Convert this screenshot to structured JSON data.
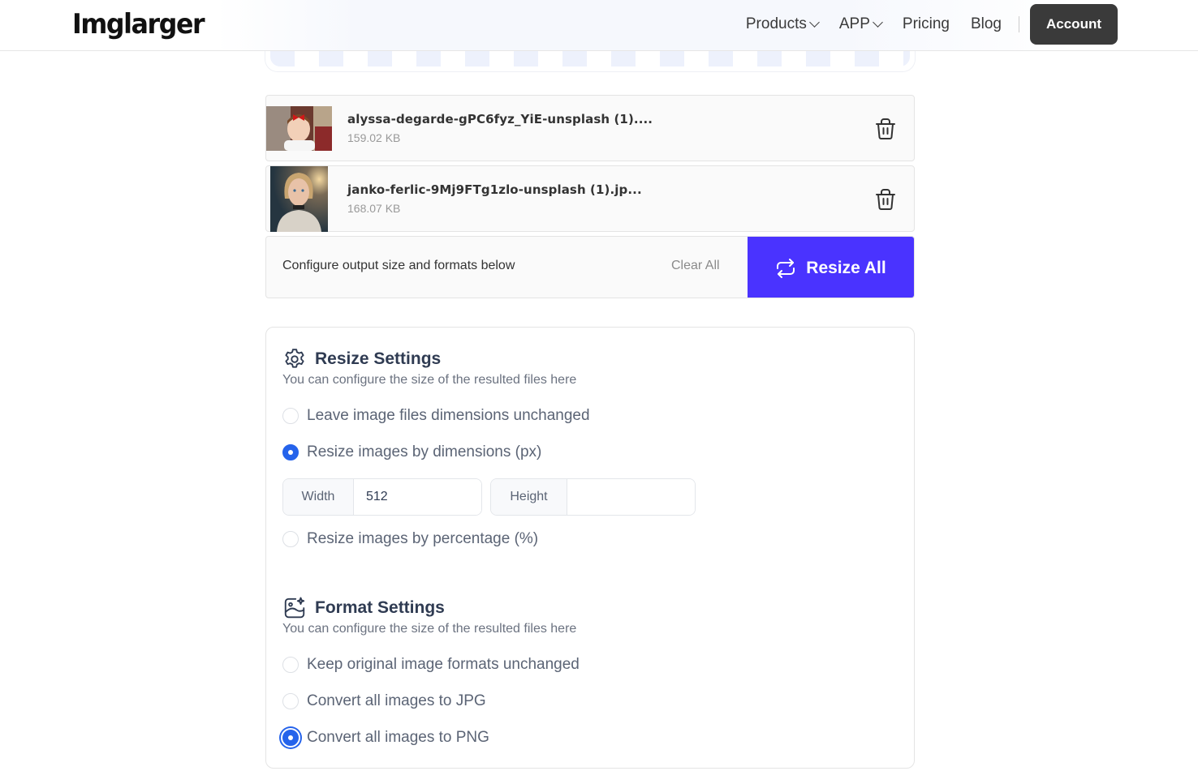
{
  "header": {
    "logo": "Imglarger",
    "nav": [
      {
        "label": "Products",
        "dropdown": true
      },
      {
        "label": "APP",
        "dropdown": true
      },
      {
        "label": "Pricing",
        "dropdown": false
      },
      {
        "label": "Blog",
        "dropdown": false
      }
    ],
    "account_label": "Account"
  },
  "files": [
    {
      "name": "alyssa-degarde-gPC6fyz_YiE-unsplash (1)....",
      "size": "159.02 KB",
      "thumb": "girl-with-red-bow"
    },
    {
      "name": "janko-ferlic-9Mj9FTg1zlo-unsplash (1).jp...",
      "size": "168.07 KB",
      "thumb": "blonde-girl-portrait"
    }
  ],
  "action_bar": {
    "hint": "Configure output size and formats below",
    "clear_label": "Clear All",
    "resize_label": "Resize All",
    "accent": "#4a33ff"
  },
  "resize_settings": {
    "title": "Resize Settings",
    "subtitle": "You can configure the size of the resulted files here",
    "options": [
      {
        "label": "Leave image files dimensions unchanged",
        "checked": false
      },
      {
        "label": "Resize images by dimensions (px)",
        "checked": true
      },
      {
        "label": "Resize images by percentage (%)",
        "checked": false
      }
    ],
    "width_label": "Width",
    "width_value": "512",
    "height_label": "Height",
    "height_value": ""
  },
  "format_settings": {
    "title": "Format Settings",
    "subtitle": "You can configure the size of the resulted files here",
    "options": [
      {
        "label": "Keep original image formats unchanged",
        "checked": false
      },
      {
        "label": "Convert all images to JPG",
        "checked": false
      },
      {
        "label": "Convert all images to PNG",
        "checked": true
      }
    ]
  }
}
